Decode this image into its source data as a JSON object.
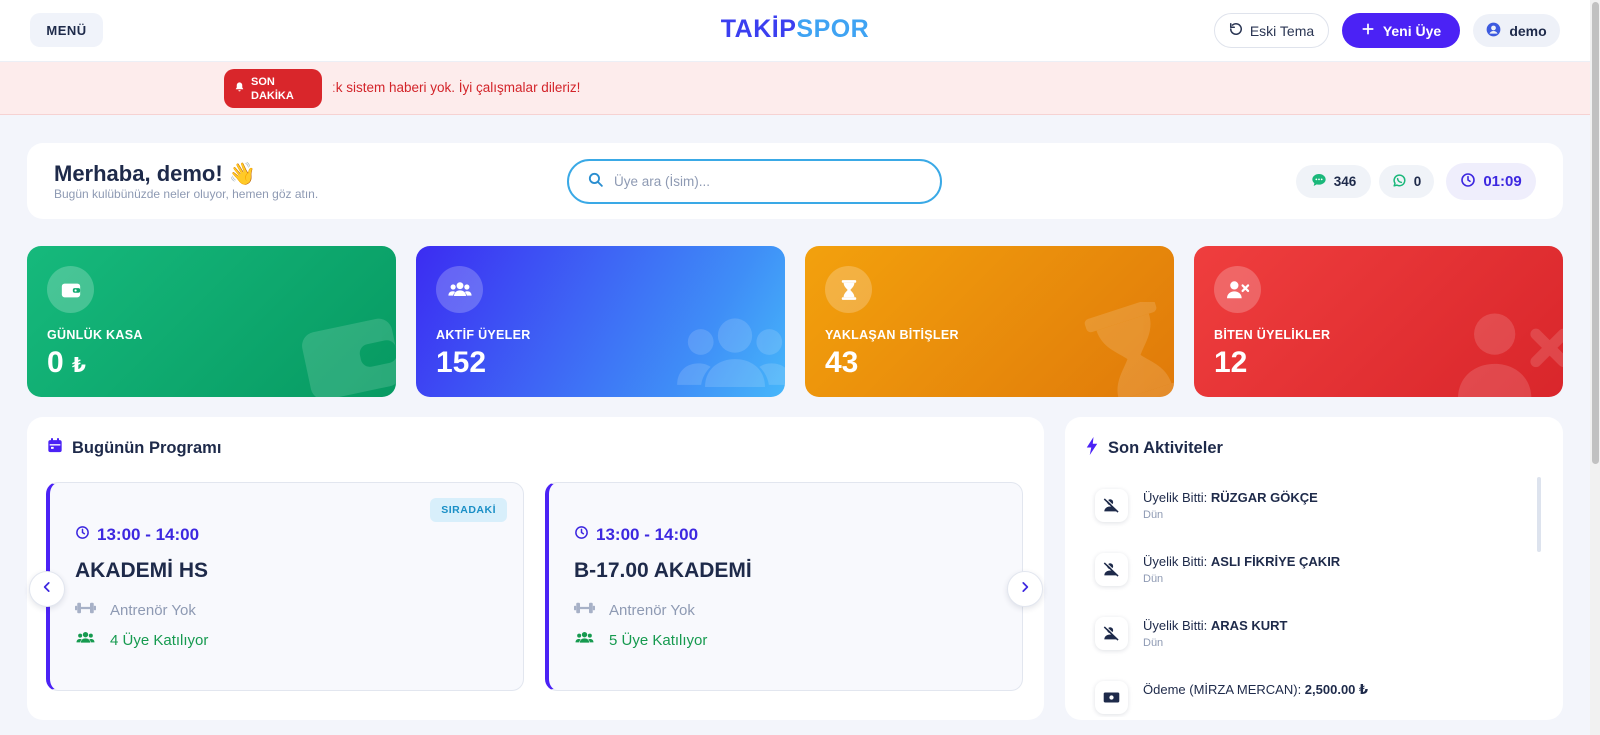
{
  "header": {
    "menu_label": "MENÜ",
    "logo_a": "TAKİP",
    "logo_b": "SPOR",
    "old_theme_label": "Eski Tema",
    "new_member_label": "Yeni Üye",
    "user_label": "demo"
  },
  "ticker": {
    "badge_line1": "SON",
    "badge_line2": "DAKİKA",
    "text": "ːk sistem haberi yok. İyi çalışmalar dileriz!"
  },
  "welcome": {
    "title": "Merhaba, demo! 👋",
    "subtitle": "Bugün kulübünüzde neler oluyor, hemen göz atın.",
    "search_placeholder": "Üye ara (İsim)...",
    "sms_count": "346",
    "whatsapp_count": "0",
    "clock": "01:09"
  },
  "stats": [
    {
      "label": "GÜNLÜK KASA",
      "value": "0",
      "currency": "₺"
    },
    {
      "label": "AKTİF ÜYELER",
      "value": "152"
    },
    {
      "label": "YAKLAŞAN BİTİŞLER",
      "value": "43"
    },
    {
      "label": "BİTEN ÜYELİKLER",
      "value": "12"
    }
  ],
  "program": {
    "title": "Bugünün Programı",
    "sessions": [
      {
        "badge": "SIRADAKİ",
        "time": "13:00 - 14:00",
        "name": "AKADEMİ HS",
        "coach": "Antrenör Yok",
        "members": "4 Üye Katılıyor"
      },
      {
        "time": "13:00 - 14:00",
        "name": "B-17.00 AKADEMİ",
        "coach": "Antrenör Yok",
        "members": "5 Üye Katılıyor"
      }
    ]
  },
  "activity": {
    "title": "Son Aktiviteler",
    "items": [
      {
        "prefix": "Üyelik Bitti: ",
        "name": "RÜZGAR GÖKÇE",
        "time": "Dün"
      },
      {
        "prefix": "Üyelik Bitti: ",
        "name": "ASLI FİKRİYE ÇAKIR",
        "time": "Dün"
      },
      {
        "prefix": "Üyelik Bitti: ",
        "name": "ARAS KURT",
        "time": "Dün"
      },
      {
        "prefix": "Ödeme (MİRZA MERCAN): ",
        "name": "2,500.00 ₺",
        "time": ""
      }
    ]
  },
  "colors": {
    "primary": "#4b22f5",
    "accent_blue": "#3fa3f3",
    "success": "#169a4f",
    "danger": "#d9262b",
    "warning": "#f3a10d"
  },
  "icons": {
    "old_theme": "undo-icon",
    "new_member": "plus-icon",
    "user": "user-circle-icon",
    "ticker": "bell-icon",
    "search": "search-icon",
    "sms": "chat-icon",
    "whatsapp": "whatsapp-icon",
    "clock": "clock-icon",
    "stats": [
      "wallet-icon",
      "users-icon",
      "hourglass-icon",
      "user-x-icon"
    ],
    "program": "calendar-icon",
    "activity": "bolt-icon"
  }
}
